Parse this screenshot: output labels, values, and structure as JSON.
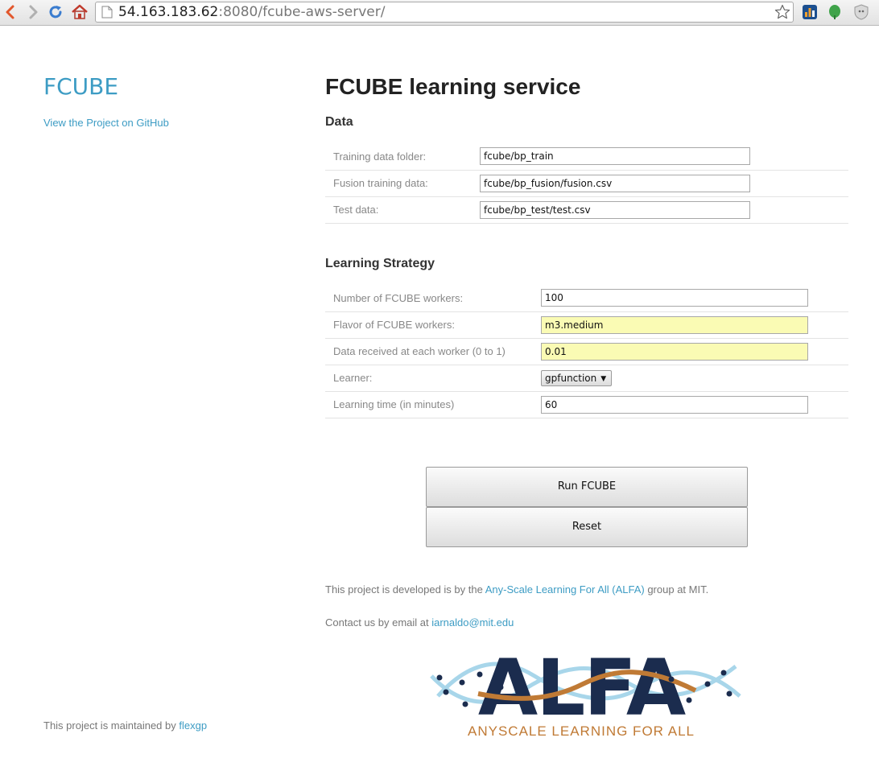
{
  "browser": {
    "url_host": "54.163.183.62",
    "url_rest": ":8080/fcube-aws-server/"
  },
  "sidebar": {
    "title": "FCUBE",
    "github_link": "View the Project on GitHub",
    "maintained_prefix": "This project is maintained by ",
    "maintained_link": "flexgp"
  },
  "main": {
    "title": "FCUBE learning service",
    "data_section": {
      "title": "Data",
      "rows": [
        {
          "label": "Training data folder:",
          "value": "fcube/bp_train"
        },
        {
          "label": "Fusion training data:",
          "value": "fcube/bp_fusion/fusion.csv"
        },
        {
          "label": "Test data:",
          "value": "fcube/bp_test/test.csv"
        }
      ]
    },
    "strategy_section": {
      "title": "Learning Strategy",
      "workers_label": "Number of FCUBE workers:",
      "workers_value": "100",
      "flavor_label": "Flavor of FCUBE workers:",
      "flavor_value": "m3.medium",
      "data_fraction_label": "Data received at each worker (0 to 1)",
      "data_fraction_value": "0.01",
      "learner_label": "Learner:",
      "learner_value": "gpfunction",
      "time_label": "Learning time (in minutes)",
      "time_value": "60"
    },
    "run_button": "Run FCUBE",
    "reset_button": "Reset",
    "developed_prefix": "This project is developed is by the ",
    "developed_link": "Any-Scale Learning For All (ALFA)",
    "developed_suffix": " group at MIT.",
    "contact_prefix": "Contact us by email at ",
    "contact_email": "iarnaldo@mit.edu",
    "logo_text": "ALFA",
    "logo_tagline": "ANYSCALE LEARNING FOR ALL"
  },
  "colors": {
    "link": "#3d9cc4",
    "logo_navy": "#1b2c4e",
    "logo_orange": "#c07a35",
    "logo_lightblue": "#a8d6ea",
    "autofill": "#fafbb4"
  },
  "icons": [
    "back-icon",
    "forward-icon",
    "reload-icon",
    "home-icon",
    "page-icon",
    "star-icon",
    "stats-extension-icon",
    "leaf-extension-icon",
    "shield-extension-icon"
  ]
}
